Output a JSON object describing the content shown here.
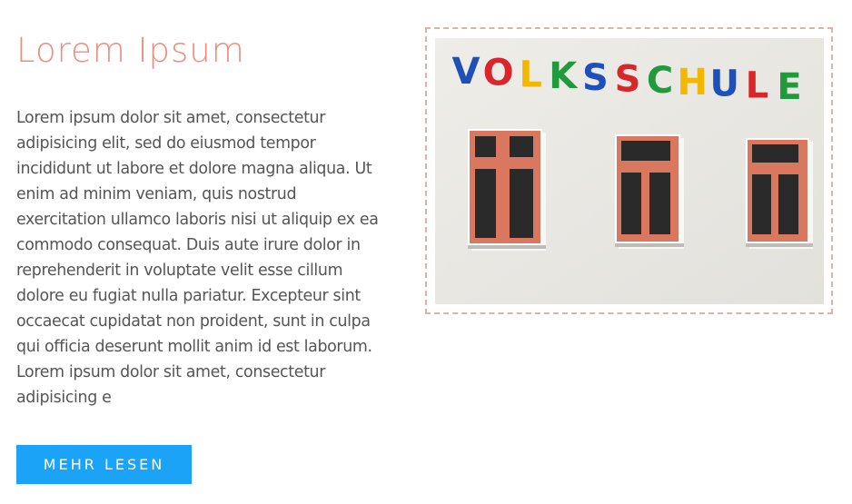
{
  "article": {
    "title": "Lorem Ipsum",
    "body": "Lorem ipsum dolor sit amet, consectetur adipisicing elit, sed do eiusmod tempor incididunt ut labore et dolore magna aliqua. Ut enim ad minim veniam, quis nostrud exercitation ullamco laboris nisi ut aliquip ex ea commodo consequat. Duis aute irure dolor in reprehenderit in voluptate velit esse cillum dolore eu fugiat nulla pariatur. Excepteur sint occaecat cupidatat non proident, sunt in culpa qui officia deserunt mollit anim id est laborum. Lorem ipsum dolor sit amet, consectetur adipisicing e",
    "button_label": "MEHR LESEN"
  },
  "image": {
    "sign_letters": [
      {
        "char": "V",
        "color": "#1f4fb8"
      },
      {
        "char": "O",
        "color": "#d8262b"
      },
      {
        "char": "L",
        "color": "#f2b800"
      },
      {
        "char": "K",
        "color": "#1f9b3d"
      },
      {
        "char": "S",
        "color": "#1f4fb8"
      },
      {
        "char": "S",
        "color": "#d8262b"
      },
      {
        "char": "C",
        "color": "#1f9b3d"
      },
      {
        "char": "H",
        "color": "#f2b800"
      },
      {
        "char": "U",
        "color": "#1f4fb8"
      },
      {
        "char": "L",
        "color": "#d8262b"
      },
      {
        "char": "E",
        "color": "#1f9b3d"
      }
    ]
  },
  "colors": {
    "title": "#ef8d7d",
    "text": "#555555",
    "button_bg": "#1aa3f7",
    "frame_border": "#d6b6a8",
    "wall": "#e9e8e3",
    "window_frame": "#d9775f"
  }
}
